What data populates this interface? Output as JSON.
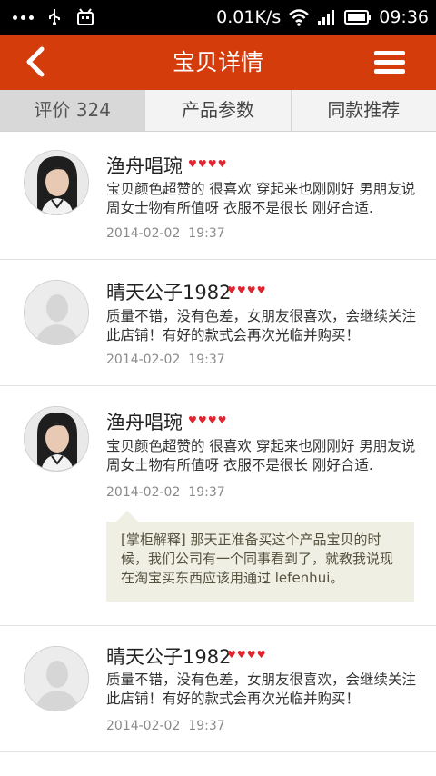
{
  "status_bar": {
    "speed": "0.01K/s",
    "time": "09:36",
    "icons": [
      "more-dots-icon",
      "usb-icon",
      "debug-icon",
      "wifi-icon",
      "signal-icon",
      "battery-icon"
    ]
  },
  "header": {
    "title": "宝贝详情",
    "back_icon": "chevron-left-icon",
    "menu_icon": "hamburger-menu-icon",
    "color": "#d53c0b"
  },
  "tabs": [
    {
      "label": "评价 324",
      "active": true
    },
    {
      "label": "产品参数",
      "active": false
    },
    {
      "label": "同款推荐",
      "active": false
    }
  ],
  "reviews": [
    {
      "user": "渔舟唱琬",
      "avatar": "female-photo-avatar",
      "rating": 4,
      "text": "宝贝颜色超赞的 很喜欢 穿起来也刚刚好 男朋友说周女士物有所值呀 衣服不是很长 刚好合适.",
      "date": "2014-02-02",
      "time": "19:37"
    },
    {
      "user": "晴天公子1982",
      "avatar": "default-avatar",
      "rating": 4,
      "text": "质量不错，没有色差，女朋友很喜欢，会继续关注此店铺！有好的款式会再次光临并购买！",
      "date": "2014-02-02",
      "time": "19:37"
    },
    {
      "user": "渔舟唱琬",
      "avatar": "female-photo-avatar",
      "rating": 4,
      "text": "宝贝颜色超赞的 很喜欢 穿起来也刚刚好 男朋友说周女士物有所值呀 衣服不是很长 刚好合适.",
      "date": "2014-02-02",
      "time": "19:37",
      "reply": "[掌柜解释]  那天正准备买这个产品宝贝的时候，我们公司有一个同事看到了，就教我说现在淘宝买东西应该用通过 lefenhui。"
    },
    {
      "user": "晴天公子1982",
      "avatar": "default-avatar",
      "rating": 4,
      "text": "质量不错，没有色差，女朋友很喜欢，会继续关注此店铺！有好的款式会再次光临并购买！",
      "date": "2014-02-02",
      "time": "19:37"
    }
  ]
}
